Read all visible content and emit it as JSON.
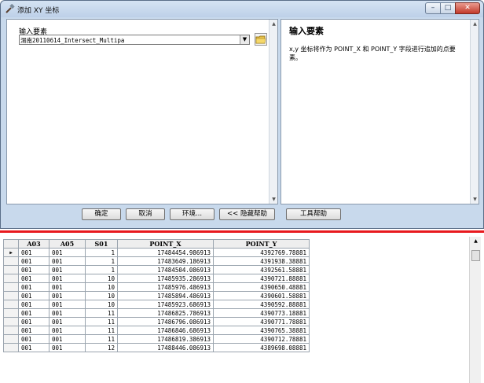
{
  "dialog": {
    "title": "添加 XY 坐标",
    "input_label": "输入要素",
    "input_value": "渭南20110614_Intersect_Multipa",
    "help_title": "输入要素",
    "help_text": "x,y 坐标将作为 POINT_X 和 POINT_Y 字段进行追加的点要素。",
    "buttons": {
      "ok": "确定",
      "cancel": "取消",
      "environments": "环境...",
      "hide_help": "<< 隐藏帮助",
      "tool_help": "工具帮助"
    }
  },
  "table": {
    "columns": [
      "A03",
      "A05",
      "S01",
      "POINT_X",
      "POINT_Y"
    ],
    "rows": [
      [
        "001",
        "001",
        "1",
        "17484454.986913",
        "4392769.78881"
      ],
      [
        "001",
        "001",
        "1",
        "17483649.186913",
        "4391938.38881"
      ],
      [
        "001",
        "001",
        "1",
        "17484504.086913",
        "4392561.58881"
      ],
      [
        "001",
        "001",
        "10",
        "17485935.286913",
        "4390721.88881"
      ],
      [
        "001",
        "001",
        "10",
        "17485976.486913",
        "4390650.48881"
      ],
      [
        "001",
        "001",
        "10",
        "17485894.486913",
        "4390601.58881"
      ],
      [
        "001",
        "001",
        "10",
        "17485923.686913",
        "4390592.88881"
      ],
      [
        "001",
        "001",
        "11",
        "17486825.786913",
        "4390773.18881"
      ],
      [
        "001",
        "001",
        "11",
        "17486796.086913",
        "4390771.78881"
      ],
      [
        "001",
        "001",
        "11",
        "17486846.686913",
        "4390765.38881"
      ],
      [
        "001",
        "001",
        "11",
        "17486819.386913",
        "4390712.78881"
      ],
      [
        "001",
        "001",
        "12",
        "17488446.086913",
        "4389698.08881"
      ]
    ]
  }
}
